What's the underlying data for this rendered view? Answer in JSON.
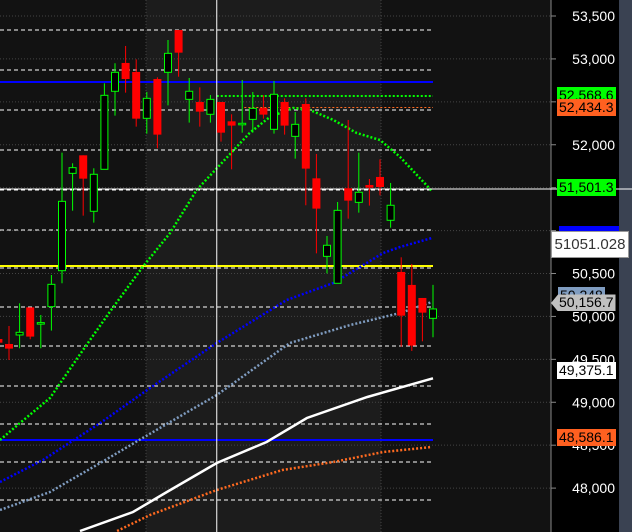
{
  "chart_data": {
    "type": "candlestick",
    "title": "",
    "xlabel": "",
    "ylabel": "",
    "ylim": [
      47500,
      53700
    ],
    "grid": true,
    "y_ticks": [
      "53,500",
      "53,000",
      "52,500",
      "52,000",
      "51,500",
      "51,000",
      "50,500",
      "50,000",
      "49,500",
      "49,000",
      "48,500",
      "48,000"
    ],
    "y_tick_values": [
      53500,
      53000,
      52500,
      52000,
      51500,
      51000,
      50500,
      50000,
      49500,
      49000,
      48500,
      48000
    ],
    "candles": [
      {
        "o": 49737,
        "h": 49737,
        "l": 49694,
        "c": 49694
      },
      {
        "o": 49679,
        "h": 49889,
        "l": 49493,
        "c": 49625
      },
      {
        "o": 49784,
        "h": 50153,
        "l": 49629,
        "c": 49815
      },
      {
        "o": 50106,
        "h": 50106,
        "l": 49734,
        "c": 49765
      },
      {
        "o": 49920,
        "h": 50017,
        "l": 49629,
        "c": 49928
      },
      {
        "o": 50114,
        "h": 50483,
        "l": 49835,
        "c": 50374
      },
      {
        "o": 50533,
        "h": 51908,
        "l": 50386,
        "c": 51341
      },
      {
        "o": 51667,
        "h": 51784,
        "l": 51232,
        "c": 51733
      },
      {
        "o": 51877,
        "h": 51877,
        "l": 51174,
        "c": 51605
      },
      {
        "o": 51225,
        "h": 51726,
        "l": 51093,
        "c": 51656
      },
      {
        "o": 51714,
        "h": 52716,
        "l": 51714,
        "c": 52576
      },
      {
        "o": 52623,
        "h": 52949,
        "l": 52339,
        "c": 52844
      },
      {
        "o": 52953,
        "h": 53151,
        "l": 52607,
        "c": 52766
      },
      {
        "o": 52848,
        "h": 52995,
        "l": 52211,
        "c": 52304
      },
      {
        "o": 52308,
        "h": 52615,
        "l": 52129,
        "c": 52541
      },
      {
        "o": 52766,
        "h": 52786,
        "l": 51959,
        "c": 52118
      },
      {
        "o": 52844,
        "h": 53221,
        "l": 52459,
        "c": 53065
      },
      {
        "o": 53337,
        "h": 53337,
        "l": 52793,
        "c": 53073
      },
      {
        "o": 52529,
        "h": 52778,
        "l": 52258,
        "c": 52623
      },
      {
        "o": 52498,
        "h": 52669,
        "l": 52211,
        "c": 52386
      },
      {
        "o": 52355,
        "h": 52580,
        "l": 52258,
        "c": 52529
      },
      {
        "o": 52498,
        "h": 52498,
        "l": 52036,
        "c": 52141
      },
      {
        "o": 52273,
        "h": 52355,
        "l": 51714,
        "c": 52223
      },
      {
        "o": 52240,
        "h": 52755,
        "l": 52141,
        "c": 52250
      },
      {
        "o": 52296,
        "h": 52615,
        "l": 52141,
        "c": 52424
      },
      {
        "o": 52428,
        "h": 52576,
        "l": 52304,
        "c": 52351
      },
      {
        "o": 52180,
        "h": 52743,
        "l": 52129,
        "c": 52588
      },
      {
        "o": 52498,
        "h": 52541,
        "l": 52118,
        "c": 52223
      },
      {
        "o": 52098,
        "h": 52382,
        "l": 51838,
        "c": 52238
      },
      {
        "o": 52475,
        "h": 52541,
        "l": 51295,
        "c": 51722
      },
      {
        "o": 51609,
        "h": 51893,
        "l": 50735,
        "c": 51256
      },
      {
        "o": 50700,
        "h": 50937,
        "l": 50502,
        "c": 50829
      },
      {
        "o": 50386,
        "h": 51333,
        "l": 50386,
        "c": 51236
      },
      {
        "o": 51493,
        "h": 52289,
        "l": 51139,
        "c": 51349
      },
      {
        "o": 51329,
        "h": 51908,
        "l": 51209,
        "c": 51446
      },
      {
        "o": 51531,
        "h": 51601,
        "l": 51291,
        "c": 51500
      },
      {
        "o": 51625,
        "h": 51830,
        "l": 51411,
        "c": 51508
      },
      {
        "o": 51120,
        "h": 51555,
        "l": 51034,
        "c": 51295
      },
      {
        "o": 50518,
        "h": 50689,
        "l": 49648,
        "c": 50009
      },
      {
        "o": 50367,
        "h": 50611,
        "l": 49598,
        "c": 49660
      },
      {
        "o": 50215,
        "h": 50215,
        "l": 49710,
        "c": 50044
      },
      {
        "o": 49978,
        "h": 50367,
        "l": 49757,
        "c": 50087
      }
    ],
    "moving_averages": [
      {
        "color": "#00ff00",
        "style": "dotted",
        "points": [
          [
            1.15,
            48560
          ],
          [
            3.04,
            48759
          ],
          [
            5.87,
            49050
          ],
          [
            8.98,
            49609
          ],
          [
            11.5,
            50052
          ],
          [
            14.6,
            50576
          ],
          [
            17.2,
            50972
          ],
          [
            19.7,
            51473
          ],
          [
            21.9,
            51764
          ],
          [
            24.7,
            52137
          ],
          [
            26.6,
            52323
          ],
          [
            28.8,
            52428
          ],
          [
            30.4,
            52405
          ],
          [
            32.6,
            52288
          ],
          [
            34.8,
            52137
          ],
          [
            37,
            52055
          ],
          [
            38.9,
            51857
          ],
          [
            41.9,
            51461
          ]
        ]
      },
      {
        "color": "#0000ff",
        "style": "dotted",
        "points": [
          [
            1.15,
            48071
          ],
          [
            5.2,
            48327
          ],
          [
            10.6,
            48759
          ],
          [
            15.3,
            49166
          ],
          [
            21.6,
            49690
          ],
          [
            28.2,
            50191
          ],
          [
            32.6,
            50390
          ],
          [
            37.3,
            50739
          ],
          [
            38.9,
            50809
          ],
          [
            41.9,
            50914
          ]
        ]
      },
      {
        "color": "#7f9cc0",
        "style": "dotted",
        "points": [
          [
            1.15,
            47745
          ],
          [
            5.87,
            47955
          ],
          [
            10.6,
            48293
          ],
          [
            14.6,
            48584
          ],
          [
            21.6,
            49085
          ],
          [
            28.5,
            49690
          ],
          [
            34.2,
            49900
          ],
          [
            38.9,
            50040
          ],
          [
            41.9,
            50168
          ]
        ]
      },
      {
        "color": "#ffffff",
        "style": "solid",
        "points": [
          [
            8.7,
            47500
          ],
          [
            13.7,
            47722
          ],
          [
            16.9,
            47955
          ],
          [
            21.6,
            48293
          ],
          [
            26.3,
            48537
          ],
          [
            30.1,
            48817
          ],
          [
            35.8,
            49061
          ],
          [
            42,
            49279
          ]
        ]
      },
      {
        "color": "#ff6a20",
        "style": "dotted",
        "points": [
          [
            12.2,
            47500
          ],
          [
            15.3,
            47687
          ],
          [
            21.6,
            47978
          ],
          [
            27.8,
            48211
          ],
          [
            32.6,
            48304
          ],
          [
            37.3,
            48421
          ],
          [
            41.9,
            48479
          ]
        ]
      }
    ],
    "levels": [
      53337,
      52871,
      52405,
      51939,
      51473,
      51007,
      50564,
      50110,
      49656,
      49190,
      48747,
      48304,
      47861
    ],
    "horizontal_lines": [
      {
        "price": 52731,
        "color": "#0000ff"
      },
      {
        "price": 48560,
        "color": "#0000ff"
      },
      {
        "price": 50588,
        "color": "#ffff00"
      }
    ],
    "reference_lines": [
      {
        "price": 52568.6,
        "color": "#00ff00",
        "from_bar": 21.6
      },
      {
        "price": 52434.3,
        "color": "#ff6a20",
        "from_bar": 24.2
      }
    ],
    "crosshair": {
      "bar": 21.6,
      "price": 51485
    },
    "price_labels": [
      {
        "text": "52,568.6",
        "price": 52568.6,
        "bg": "#00ff00"
      },
      {
        "text": "52,434.3",
        "price": 52434.3,
        "bg": "#ff6020"
      },
      {
        "text": "51,501.3",
        "price": 51501.3,
        "bg": "#00ff00"
      },
      {
        "text": "50,248",
        "price": 50248,
        "bg": "#7f9cc0"
      },
      {
        "text": "50,156.7",
        "price": 50156.7,
        "bg": "#c0c0c0"
      },
      {
        "text": "49,375.1",
        "price": 49375.1,
        "bg": "#ffffff"
      },
      {
        "text": "48,586.1",
        "price": 48586.1,
        "bg": "#ff6020"
      }
    ],
    "tooltip": "51051.028",
    "colors": {
      "up": "#00ff00",
      "down": "#ff0000",
      "background": "#121212",
      "axis_bg": "#000000"
    }
  }
}
